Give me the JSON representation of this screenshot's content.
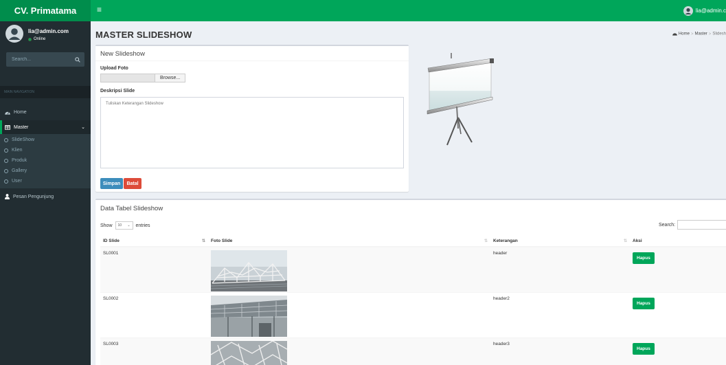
{
  "app": {
    "title": "CV. Primatama"
  },
  "navbar": {
    "user_label": "lia@admin.c"
  },
  "sidebar": {
    "user_name": "lia@admin.com",
    "user_status": "Online",
    "search_placeholder": "Search...",
    "header": "MAIN NAVIGATION",
    "items": [
      {
        "label": "Home"
      },
      {
        "label": "Master"
      },
      {
        "label": "Pesan Pengunjung"
      }
    ],
    "submenu": [
      {
        "label": "SlideShow"
      },
      {
        "label": "Klien"
      },
      {
        "label": "Produk"
      },
      {
        "label": "Gallery"
      },
      {
        "label": "User"
      }
    ]
  },
  "page": {
    "title": "MASTER SLIDESHOW"
  },
  "breadcrumb": {
    "home": "Home",
    "master": "Master",
    "current": "Slidesh"
  },
  "form": {
    "title": "New Slideshow",
    "upload_label": "Upload Foto",
    "browse_label": "Browse...",
    "desc_label": "Deskripsi Slide",
    "desc_placeholder": "Tuliskan Keterangan Slideshow",
    "save_label": "Simpan",
    "cancel_label": "Batal"
  },
  "table": {
    "title": "Data Tabel Slideshow",
    "show_label": "Show",
    "page_length": "10",
    "entries_label": "entries",
    "search_label": "Search:",
    "columns": [
      "ID Slide",
      "Foto Slide",
      "Keterangan",
      "Aksi"
    ],
    "rows": [
      {
        "id": "SL0001",
        "keterangan": "header",
        "action": "Hapus"
      },
      {
        "id": "SL0002",
        "keterangan": "header2",
        "action": "Hapus"
      },
      {
        "id": "SL0003",
        "keterangan": "header3",
        "action": "Hapus"
      }
    ]
  },
  "colors": {
    "brand": "#00a65a",
    "sidebar": "#222d32",
    "primary": "#3c8dbc",
    "danger": "#dd4b39"
  }
}
